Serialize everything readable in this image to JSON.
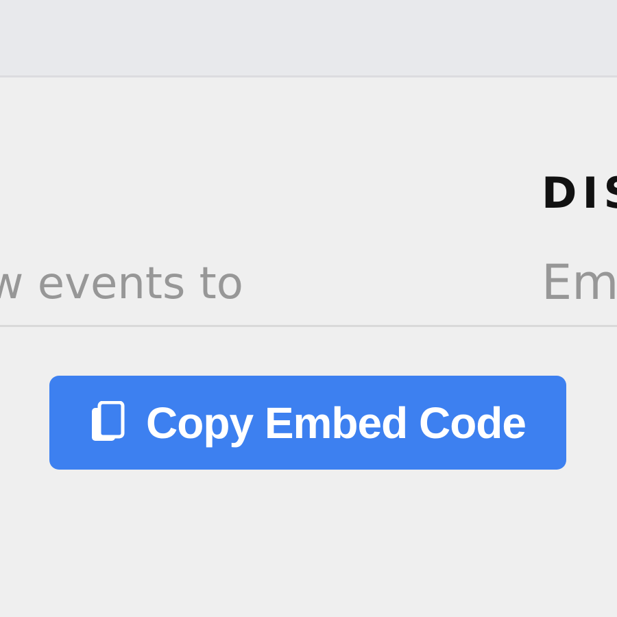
{
  "embed_field": {
    "visible_value": "w events to"
  },
  "display_section": {
    "heading": "DIS",
    "field_value": "Em"
  },
  "copy_button": {
    "label": "Copy Embed Code",
    "icon": "copy-icon"
  },
  "colors": {
    "background": "#efefef",
    "top_band": "#e8e9ec",
    "accent": "#3d80f0",
    "placeholder_text": "#979797",
    "heading_text": "#111111"
  }
}
